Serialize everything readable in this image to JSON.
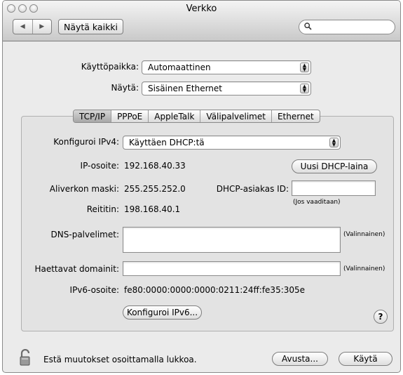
{
  "window": {
    "title": "Verkko"
  },
  "toolbar": {
    "show_all_label": "Näytä kaikki",
    "back_glyph": "◀",
    "forward_glyph": "▶"
  },
  "search": {
    "value": ""
  },
  "location": {
    "label": "Käyttöpaikka:",
    "value": "Automaattinen"
  },
  "show": {
    "label": "Näytä:",
    "value": "Sisäinen Ethernet"
  },
  "tabs": [
    "TCP/IP",
    "PPPoE",
    "AppleTalk",
    "Välipalvelimet",
    "Ethernet"
  ],
  "active_tab": "TCP/IP",
  "tcpip": {
    "configure_label": "Konfiguroi IPv4:",
    "configure_value": "Käyttäen DHCP:tä",
    "ip_label": "IP-osoite:",
    "ip_value": "192.168.40.33",
    "renew_button": "Uusi DHCP-laina",
    "subnet_label": "Aliverkon maski:",
    "subnet_value": "255.255.252.0",
    "client_id_label": "DHCP-asiakas ID:",
    "client_id_value": "",
    "if_required": "(Jos vaaditaan)",
    "router_label": "Reititin:",
    "router_value": "198.168.40.1",
    "dns_label": "DNS-palvelimet:",
    "dns_value": "",
    "optional_1": "(Valinnainen)",
    "search_domains_label": "Haettavat domainit:",
    "search_domains_value": "",
    "optional_2": "(Valinnainen)",
    "ipv6_label": "IPv6-osoite:",
    "ipv6_value": "fe80:0000:0000:0000:0211:24ff:fe35:305e",
    "configure_ipv6_button": "Konfiguroi IPv6...",
    "help_glyph": "?"
  },
  "footer": {
    "lock_text": "Estä muutokset osoittamalla lukkoa.",
    "assist_button": "Avusta...",
    "apply_button": "Käytä"
  }
}
